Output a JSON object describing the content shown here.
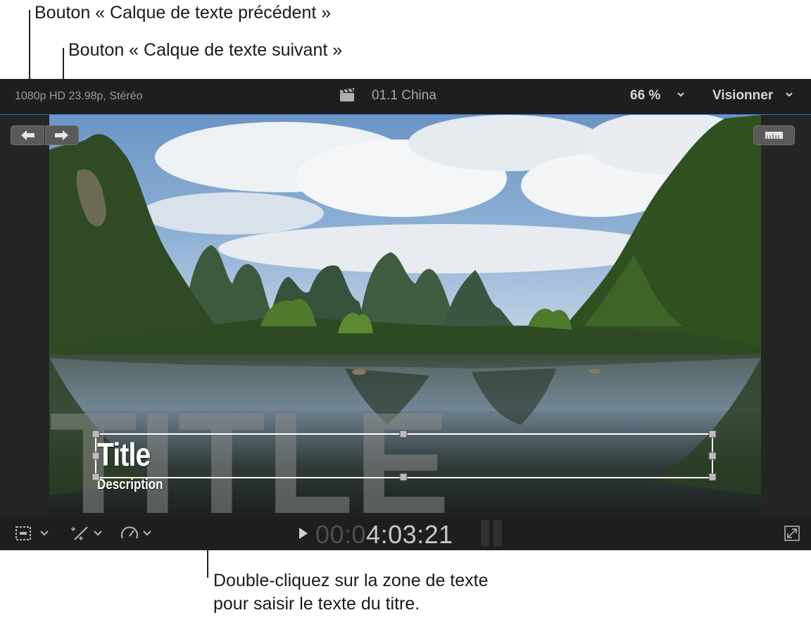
{
  "callouts": {
    "prev_button": "Bouton « Calque de texte précédent »",
    "next_button": "Bouton « Calque de texte suivant »",
    "text_box_line1": "Double-cliquez sur la zone de texte",
    "text_box_line2": "pour saisir le texte du titre."
  },
  "viewer": {
    "format_info": "1080p HD 23.98p, Stéréo",
    "clip_name": "01.1 China",
    "zoom": "66 %",
    "view_menu": "Visionner",
    "title_overlay": {
      "background_word": "TITLE",
      "title": "Title",
      "description": "Description"
    },
    "timecode": {
      "dim": "00:0",
      "bright": "4:03:21"
    }
  },
  "colors": {
    "selection": "#3d6bd8",
    "toolbar_bg": "#1e1e1e",
    "viewer_bg": "#252525"
  },
  "icons": {
    "prev": "arrow-left-icon",
    "next": "arrow-right-icon",
    "clip": "clapper-icon",
    "ruler": "ruler-icon",
    "crop": "crop-icon",
    "magic": "magic-wand-icon",
    "speed": "speedometer-icon",
    "play": "play-icon",
    "fullscreen": "fullscreen-icon"
  }
}
